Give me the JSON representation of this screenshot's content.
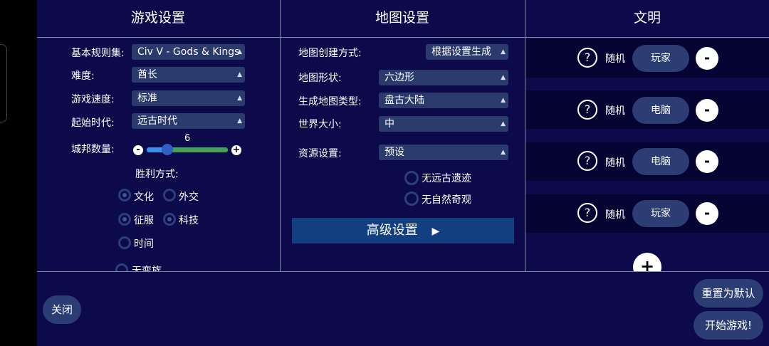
{
  "headers": {
    "game": "游戏设置",
    "map": "地图设置",
    "civ": "文明"
  },
  "game": {
    "ruleset_label": "基本规则集:",
    "ruleset_value": "Civ V - Gods & Kings",
    "difficulty_label": "难度:",
    "difficulty_value": "酋长",
    "speed_label": "游戏速度:",
    "speed_value": "标准",
    "era_label": "起始时代:",
    "era_value": "远古时代",
    "citystates_label": "城邦数量:",
    "citystates_value": "6",
    "citystates_fraction": 0.25,
    "victory_label": "胜利方式:",
    "victories": [
      {
        "label": "文化",
        "checked": true
      },
      {
        "label": "外交",
        "checked": false
      },
      {
        "label": "征服",
        "checked": true
      },
      {
        "label": "科技",
        "checked": true
      },
      {
        "label": "时间",
        "checked": false
      }
    ],
    "cut_option": "无变族"
  },
  "map": {
    "creation_label": "地图创建方式:",
    "creation_value": "根据设置生成",
    "shape_label": "地图形状:",
    "shape_value": "六边形",
    "type_label": "生成地图类型:",
    "type_value": "盘古大陆",
    "size_label": "世界大小:",
    "size_value": "中",
    "resource_label": "资源设置:",
    "resource_value": "预设",
    "options": [
      {
        "label": "无远古遗迹",
        "checked": false
      },
      {
        "label": "无自然奇观",
        "checked": false
      }
    ],
    "advanced_label": "高级设置"
  },
  "civ": {
    "rows": [
      {
        "random": "随机",
        "role": "玩家"
      },
      {
        "random": "随机",
        "role": "电脑"
      },
      {
        "random": "随机",
        "role": "电脑"
      },
      {
        "random": "随机",
        "role": "玩家"
      }
    ],
    "question": "?",
    "minus": "-",
    "plus": "+"
  },
  "footer": {
    "close": "关闭",
    "reset": "重置为默认",
    "start": "开始游戏!"
  },
  "colors": {
    "background": "#0c0a4a",
    "dropdown": "#2b3a6c",
    "button": "#2b3d73",
    "advanced": "#123f80",
    "slider_left": "#3b8fe8",
    "slider_right": "#45a15a"
  }
}
